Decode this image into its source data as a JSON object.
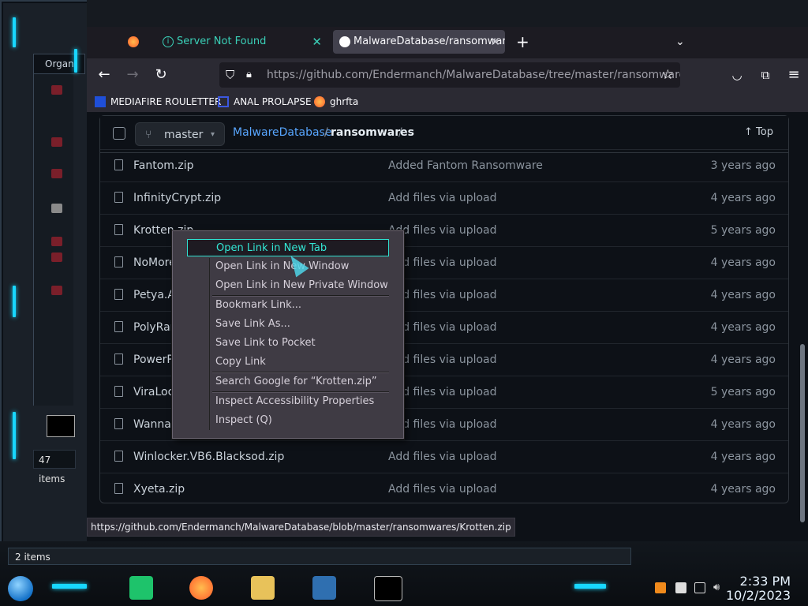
{
  "left_window": {
    "title": "Organ",
    "status": "47 items"
  },
  "browser": {
    "tabs": [
      {
        "label": "",
        "icon": "firefox-icon"
      },
      {
        "label": "Server Not Found",
        "icon": "info-icon"
      },
      {
        "label": "MalwareDatabase/ransomware",
        "icon": "github-icon"
      }
    ],
    "new_tab": "+",
    "url": "https://github.com/Endermanch/MalwareDatabase/tree/master/ransomwares",
    "bookmarks": [
      {
        "label": "MEDIAFIRE ROULETTER",
        "icon": "mediafire-icon"
      },
      {
        "label": "ANAL PROLAPSE",
        "icon": "bookmark-icon"
      },
      {
        "label": "ghrfta",
        "icon": "firefox-icon"
      }
    ],
    "status_link": "https://github.com/Endermanch/MalwareDatabase/blob/master/ransomwares/Krotten.zip"
  },
  "repo": {
    "branch": "master",
    "breadcrumb_repo": "MalwareDatabase",
    "breadcrumb_sep": "/",
    "breadcrumb_folder": "ransomwares",
    "breadcrumb_trail": "/",
    "top_label": "Top",
    "files": [
      {
        "name": "Fantom.zip",
        "message": "Added Fantom Ransomware",
        "age": "3 years ago"
      },
      {
        "name": "InfinityCrypt.zip",
        "message": "Add files via upload",
        "age": "4 years ago"
      },
      {
        "name": "Krotten.zip",
        "message": "Add files via upload",
        "age": "5 years ago"
      },
      {
        "name": "NoMore",
        "message": "Add files via upload",
        "age": "4 years ago"
      },
      {
        "name": "Petya.A.",
        "message": "Add files via upload",
        "age": "4 years ago"
      },
      {
        "name": "PolyRans",
        "message": "Add files via upload",
        "age": "4 years ago"
      },
      {
        "name": "PowerPo",
        "message": "Add files via upload",
        "age": "4 years ago"
      },
      {
        "name": "ViraLock",
        "message": "Add files via upload",
        "age": "5 years ago"
      },
      {
        "name": "WannaC",
        "message": "Add files via upload",
        "age": "4 years ago"
      },
      {
        "name": "Winlocker.VB6.Blacksod.zip",
        "message": "Add files via upload",
        "age": "4 years ago"
      },
      {
        "name": "Xyeta.zip",
        "message": "Add files via upload",
        "age": "4 years ago"
      }
    ]
  },
  "context_menu": {
    "items": [
      "Open Link in New Tab",
      "Open Link in New Window",
      "Open Link in New Private Window",
      "Bookmark Link...",
      "Save Link As...",
      "Save Link to Pocket",
      "Copy Link",
      "Search Google for “Krotten.zip”",
      "Inspect Accessibility Properties",
      "Inspect (Q)"
    ]
  },
  "taskbar": {
    "items_count": "2 items",
    "time": "2:33 PM",
    "date": "10/2/2023"
  },
  "colors": {
    "accent_cyan": "#18d7ff",
    "github_link": "#58a6ff",
    "menu_highlight": "#33e6d4"
  }
}
